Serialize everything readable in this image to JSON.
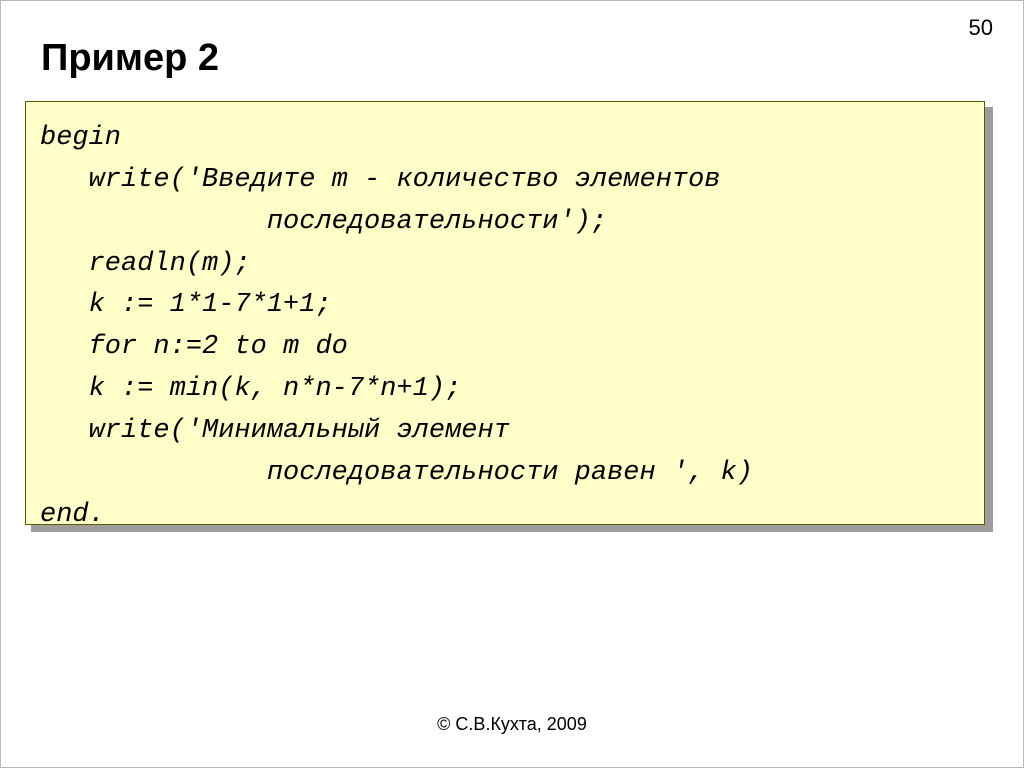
{
  "page_number": "50",
  "title": "Пример 2",
  "code": {
    "l1": "begin",
    "l2": "   write('Введите m - количество элементов",
    "l3": "              последовательности');",
    "l4": "   readln(m);",
    "l5": "   k := 1*1-7*1+1;",
    "l6": "   for n:=2 to m do",
    "l7": "   k := min(k, n*n-7*n+1);",
    "l8": "   write('Минимальный элемент",
    "l9": "              последовательности равен ', k)",
    "l10": "end."
  },
  "footer": "© С.В.Кухта, 2009"
}
